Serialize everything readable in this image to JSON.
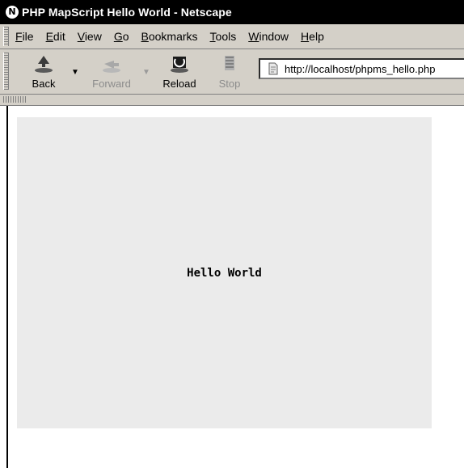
{
  "window": {
    "title": "PHP MapScript Hello World - Netscape",
    "app_icon_glyph": "N"
  },
  "menu": [
    {
      "mnemonic": "F",
      "rest": "ile"
    },
    {
      "mnemonic": "E",
      "rest": "dit"
    },
    {
      "mnemonic": "V",
      "rest": "iew"
    },
    {
      "mnemonic": "G",
      "rest": "o"
    },
    {
      "mnemonic": "B",
      "rest": "ookmarks"
    },
    {
      "mnemonic": "T",
      "rest": "ools"
    },
    {
      "mnemonic": "W",
      "rest": "indow"
    },
    {
      "mnemonic": "H",
      "rest": "elp"
    }
  ],
  "toolbar": {
    "back_label": "Back",
    "forward_label": "Forward",
    "reload_label": "Reload",
    "stop_label": "Stop"
  },
  "address": {
    "url": "http://localhost/phpms_hello.php"
  },
  "map": {
    "label": "Hello World",
    "background": "#ebebeb"
  }
}
